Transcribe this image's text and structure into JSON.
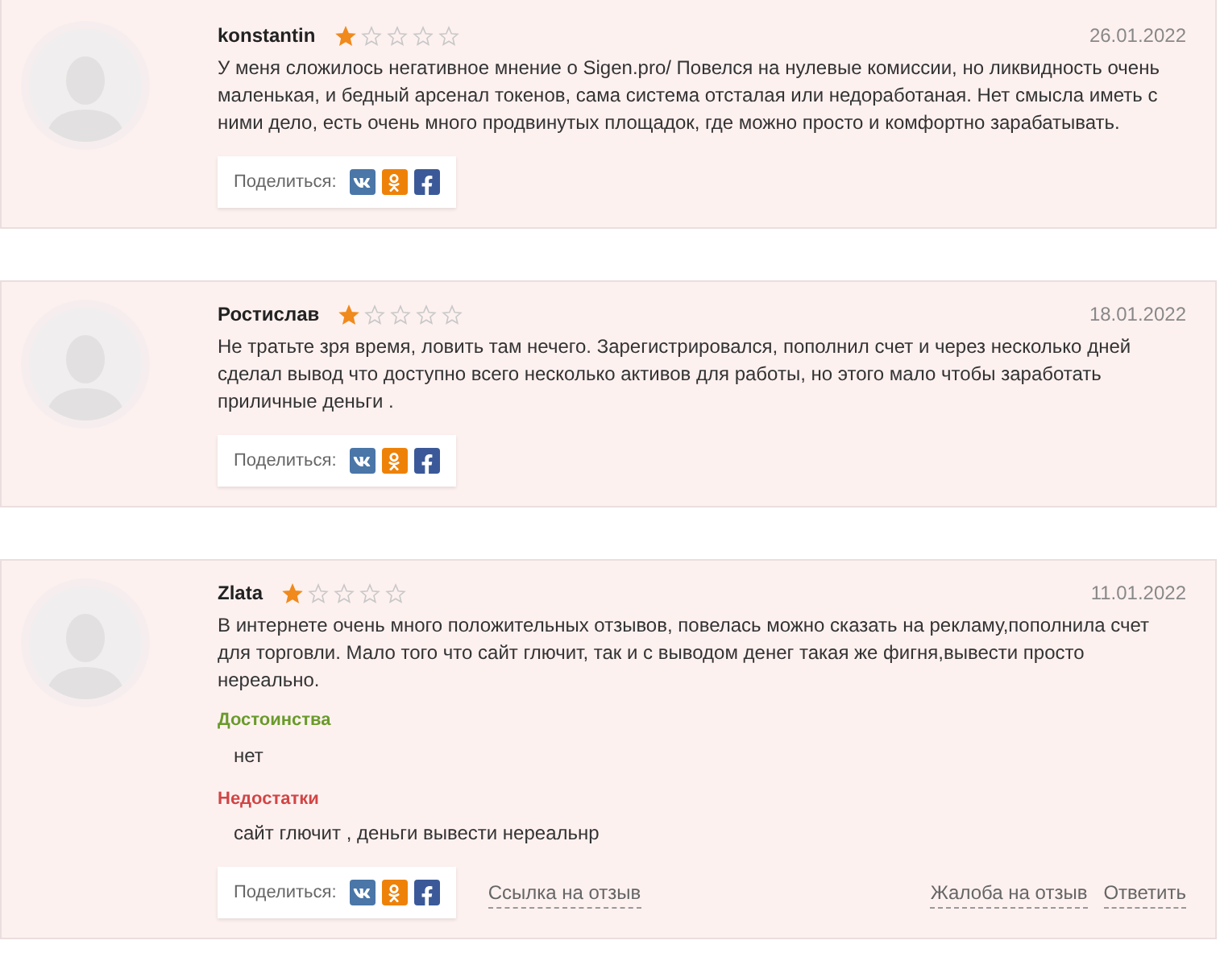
{
  "reviews": [
    {
      "author": "konstantin",
      "stars": 1,
      "date": "26.01.2022",
      "text": "У меня сложилось негативное мнение о Sigen.pro/ Повелся на нулевые комиссии, но ликвидность очень маленькая, и бедный арсенал токенов, сама система отсталая или недоработаная. Нет смысла иметь с ними дело, есть очень много продвинутых площадок, где можно просто и комфортно зарабатывать.",
      "share_label": "Поделиться:"
    },
    {
      "author": "Ростислав",
      "stars": 1,
      "date": "18.01.2022",
      "text": "Не тратьте зря время, ловить там нечего. Зарегистрировался, пополнил счет и через несколько дней сделал вывод что доступно всего несколько активов для работы, но этого мало чтобы заработать приличные деньги .",
      "share_label": "Поделиться:"
    },
    {
      "author": "Zlata",
      "stars": 1,
      "date": "11.01.2022",
      "text": "В интернете очень много положительных отзывов, повелась можно сказать на рекламу,пополнила счет для торговли. Мало того что сайт глючит, так и с выводом денег такая же фигня,вывести просто нереально.",
      "pros_label": "Достоинства",
      "pros": "нет",
      "cons_label": "Недостатки",
      "cons": "сайт глючит , деньги вывести нереальнр",
      "share_label": "Поделиться:",
      "link": "Ссылка на отзыв",
      "complaint": "Жалоба на отзыв",
      "reply": "Ответить"
    }
  ]
}
